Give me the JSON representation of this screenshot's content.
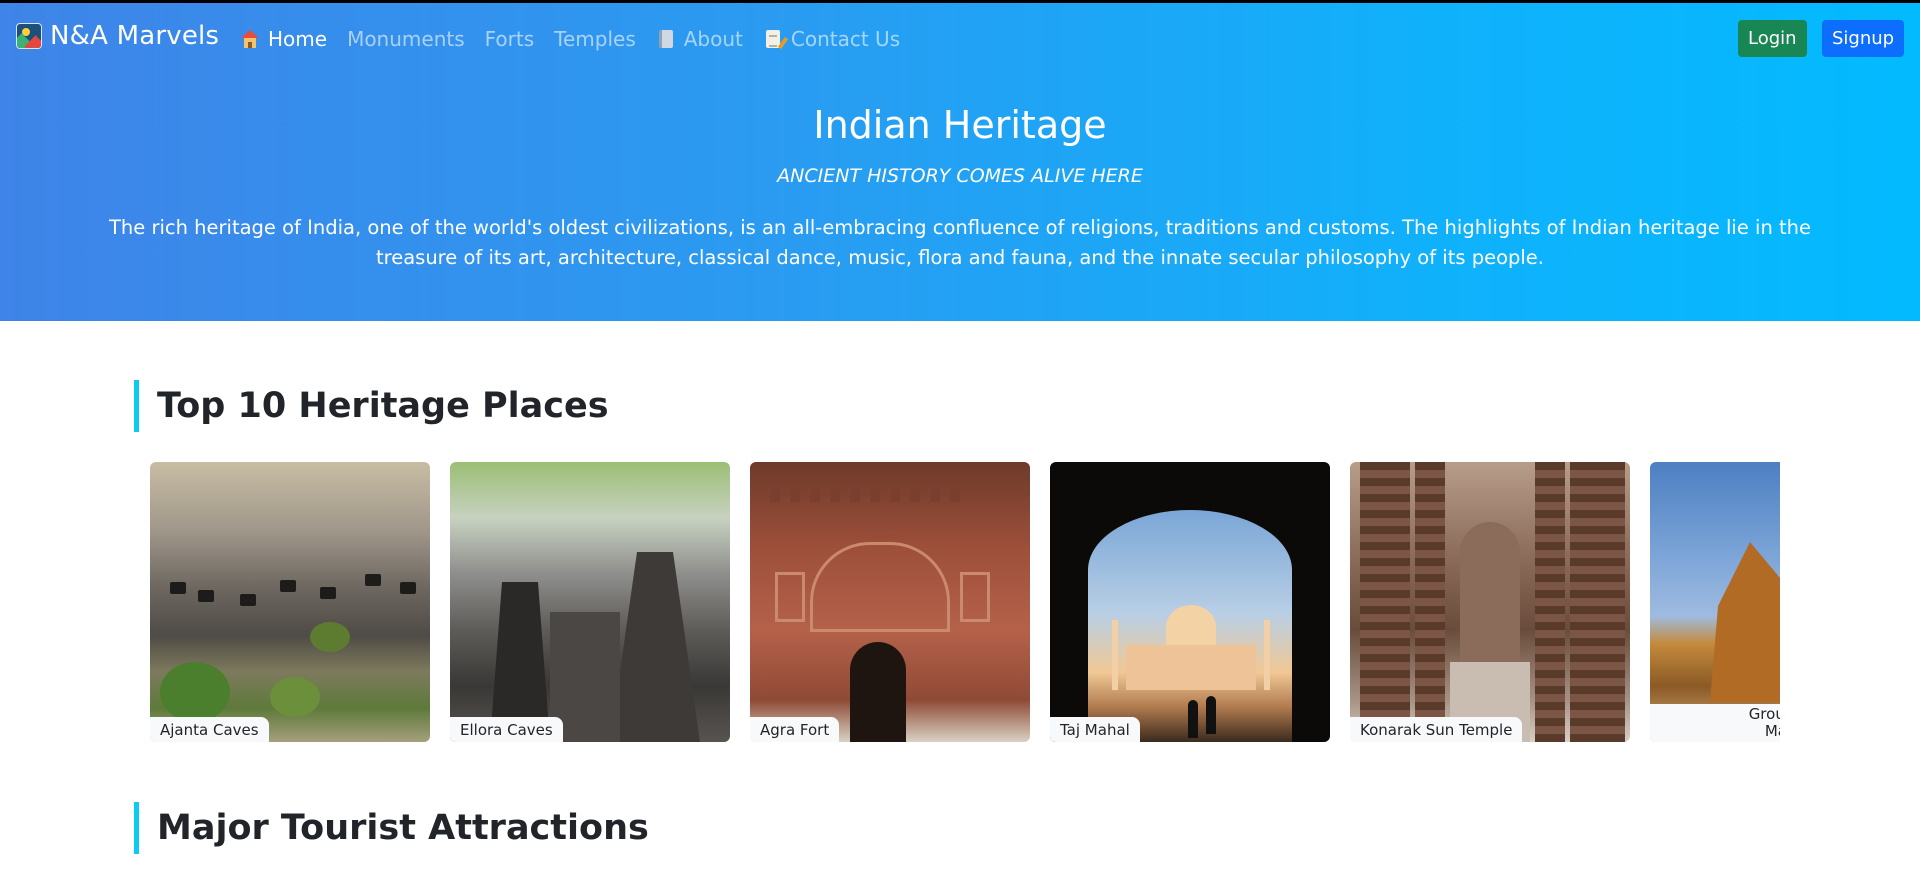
{
  "brand": {
    "name": "N&A Marvels"
  },
  "nav": {
    "items": [
      {
        "label": "Home",
        "active": true,
        "icon": "house-icon"
      },
      {
        "label": "Monuments",
        "active": false
      },
      {
        "label": "Forts",
        "active": false
      },
      {
        "label": "Temples",
        "active": false
      },
      {
        "label": "About",
        "active": false,
        "icon": "book-icon"
      },
      {
        "label": "Contact Us",
        "active": false,
        "icon": "memo-icon"
      }
    ],
    "login_label": "Login",
    "signup_label": "Signup"
  },
  "hero": {
    "title": "Indian Heritage",
    "subtitle": "ANCIENT HISTORY COMES ALIVE HERE",
    "description": "The rich heritage of India, one of the world's oldest civilizations, is an all-embracing confluence of religions, traditions and customs. The highlights of Indian heritage lie in the treasure of its art, architecture, classical dance, music, flora and fauna, and the innate secular philosophy of its people."
  },
  "sections": {
    "top_places_title": "Top 10 Heritage Places",
    "attractions_title": "Major Tourist Attractions"
  },
  "places": [
    {
      "caption": "Ajanta Caves"
    },
    {
      "caption": "Ellora Caves"
    },
    {
      "caption": "Agra Fort"
    },
    {
      "caption": "Taj Mahal"
    },
    {
      "caption": "Konarak Sun Temple"
    },
    {
      "caption_line1": "Group of M",
      "caption_line2": "Mahab"
    }
  ],
  "colors": {
    "hero_gradient_start": "#3f84e8",
    "hero_gradient_end": "#03baff",
    "login_button": "#198754",
    "signup_button": "#0d6efd",
    "section_accent": "#0dcaf0"
  }
}
